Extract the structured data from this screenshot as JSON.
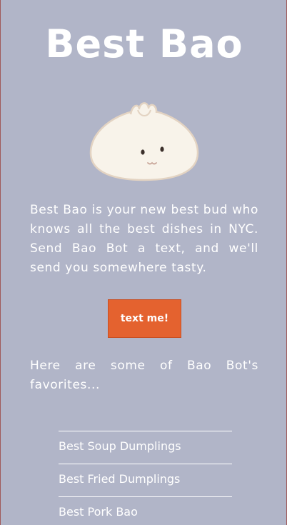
{
  "header": {
    "title": "Best Bao"
  },
  "mascot": {
    "icon": "bao-bun-icon",
    "colors": {
      "bun": "#f8f3ea",
      "outline": "#e3d3c2",
      "face": "#3b2f2a",
      "mouth": "#c9a79a"
    }
  },
  "intro": {
    "text": "Best Bao is your new best bud who knows all the best dishes in NYC. Send Bao Bot a text, and we'll send you somewhere tasty."
  },
  "cta": {
    "label": "text me!",
    "color": "#e4622f"
  },
  "favorites": {
    "intro": "Here are some of Bao Bot's favorites...",
    "items": [
      {
        "label": "Best Soup Dumplings"
      },
      {
        "label": "Best Fried Dumplings"
      },
      {
        "label": "Best Pork Bao"
      }
    ]
  },
  "theme": {
    "background": "#b1b5c8",
    "text": "#ffffff"
  }
}
